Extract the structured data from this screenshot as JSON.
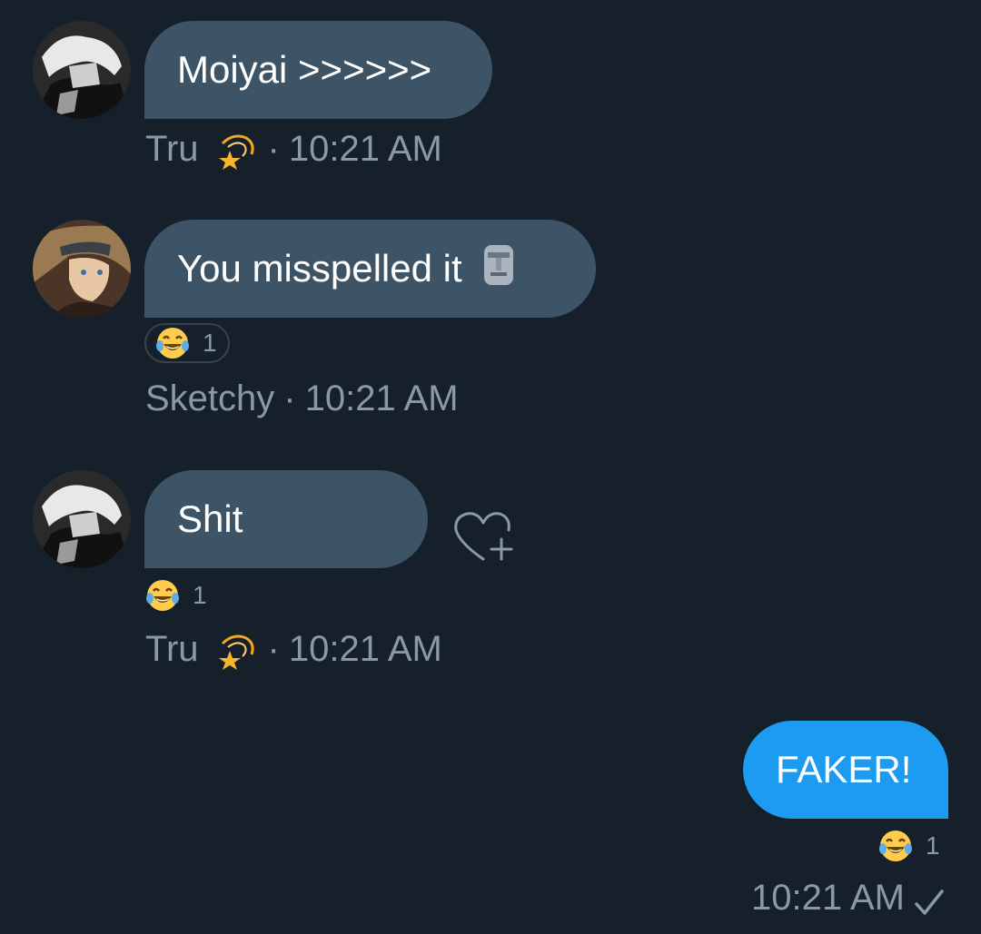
{
  "messages": [
    {
      "text": "Moiyai >>>>>>",
      "sender": "Tru",
      "time": "10:21 AM"
    },
    {
      "text": "You misspelled it",
      "sender": "Sketchy",
      "time": "10:21 AM",
      "reaction_count": "1"
    },
    {
      "text": "Shit",
      "sender": "Tru",
      "time": "10:21 AM",
      "reaction_count": "1"
    },
    {
      "text": "FAKER!",
      "time": "10:21 AM",
      "reaction_count": "1"
    }
  ],
  "separator": "·",
  "colors": {
    "background": "#15202b",
    "received_bubble": "#3d5466",
    "sent_bubble": "#1d9bf0",
    "meta_text": "#8b98a5"
  },
  "icons": [
    "avatar",
    "dizzy-star-emoji",
    "moai-emoji",
    "face-with-tears-of-joy-emoji",
    "heart-add-icon",
    "checkmark-icon"
  ]
}
